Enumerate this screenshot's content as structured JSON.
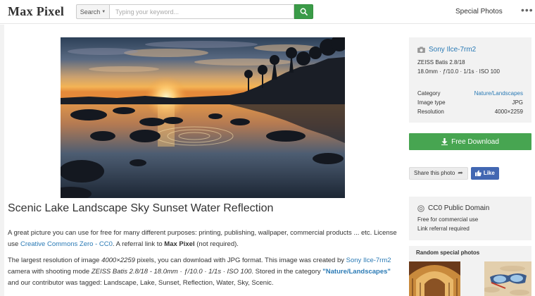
{
  "header": {
    "logo": "Max Pixel",
    "search_category": "Search",
    "search_placeholder": "Typing your keyword...",
    "special_link": "Special Photos"
  },
  "photo": {
    "title": "Scenic Lake Landscape Sky Sunset Water Reflection"
  },
  "description": {
    "p1_a": "A great picture you can use for free for many different purposes: printing, publishing, wallpaper, commercial products ... etc. License use ",
    "p1_link": "Creative Commons Zero - CC0",
    "p1_b": ". A referral link to ",
    "p1_bold": "Max Pixel",
    "p1_c": " (not required).",
    "p2_a": "The largest resolution of image ",
    "p2_res": "4000×2259",
    "p2_b": " pixels, you can download with JPG format. This image was created by ",
    "p2_camera": "Sony Ilce-7rm2",
    "p2_c": " camera with shooting mode ",
    "p2_mode": "ZEISS Batis 2.8/18 - 18.0mm · ƒ/10.0 · 1/1s · ISO 100",
    "p2_d": ". Stored in the category ",
    "p2_category": "\"Nature/Landscapes\"",
    "p2_e": " and our contributor was tagged: Landscape, Lake, Sunset, Reflection, Water, Sky, Scenic."
  },
  "sidebar": {
    "camera": "Sony Ilce-7rm2",
    "lens": "ZEISS Batis 2.8/18",
    "exposure": "18.0mm · ƒ/10.0 · 1/1s · ISO 100",
    "meta": [
      {
        "label": "Category",
        "value": "Nature/Landscapes"
      },
      {
        "label": "Image type",
        "value": "JPG"
      },
      {
        "label": "Resolution",
        "value": "4000×2259"
      }
    ],
    "download_label": "Free Download",
    "share_label": "Share this photo",
    "like_label": "Like",
    "license_title": "CC0 Public Domain",
    "license_line1": "Free for commercial use",
    "license_line2": "Link referral required",
    "random_title": "Random special photos"
  },
  "colors": {
    "link": "#2a7ab5",
    "download_green": "#47a551",
    "search_green": "#3a9b48",
    "facebook_blue": "#4267b2"
  },
  "icons": [
    "search-icon",
    "more-dots-icon",
    "camera-icon",
    "download-icon",
    "share-arrow-icon",
    "thumbs-up-icon",
    "cc-icon"
  ]
}
